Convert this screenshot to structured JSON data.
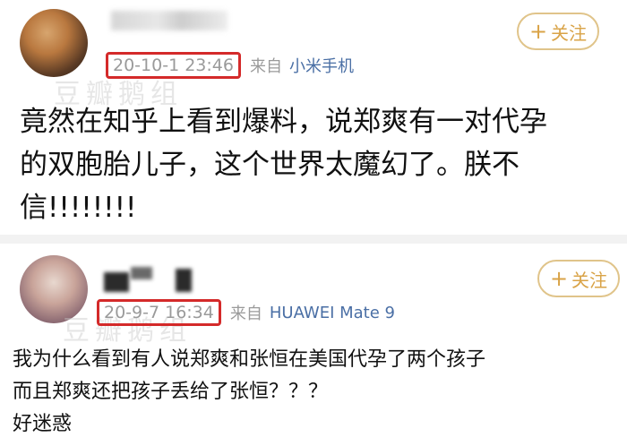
{
  "posts": [
    {
      "follow_label": "关注",
      "timestamp": "20-10-1 23:46",
      "source_prefix": "来自",
      "device": "小米手机",
      "content_lines": [
        "竟然在知乎上看到爆料，说郑爽有一对代孕",
        "的双胞胎儿子，这个世界太魔幻了。朕不",
        "信!!!!!!!!"
      ]
    },
    {
      "follow_label": "关注",
      "timestamp": "20-9-7 16:34",
      "source_prefix": "来自",
      "device": "HUAWEI Mate 9",
      "content_lines": [
        "我为什么看到有人说郑爽和张恒在美国代孕了两个孩子",
        "而且郑爽还把孩子丢给了张恒？？？",
        "好迷惑"
      ]
    }
  ],
  "watermark_text": "豆瓣鹅组",
  "colors": {
    "timestamp_border": "#d42a2a",
    "follow_accent": "#d9a347",
    "device_link": "#4a6fa5",
    "meta_gray": "#9a9a9a"
  },
  "icons": [
    "plus-icon"
  ]
}
